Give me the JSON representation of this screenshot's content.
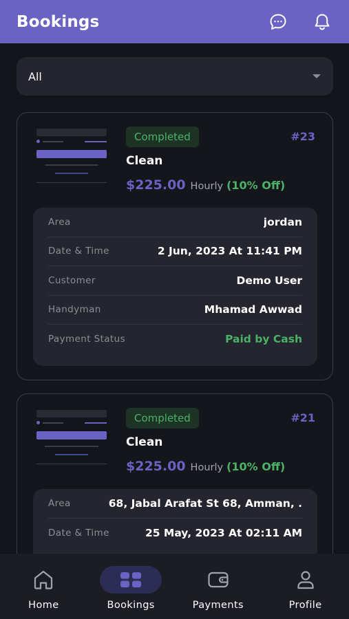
{
  "header": {
    "title": "Bookings",
    "chat_icon": "chat-bubble-icon",
    "bell_icon": "bell-icon"
  },
  "filter": {
    "selected": "All"
  },
  "bookings": [
    {
      "status": "Completed",
      "id": "#23",
      "service": "Clean",
      "price": "$225.00",
      "price_type": "Hourly",
      "discount": "(10% Off)",
      "details": [
        {
          "label": "Area",
          "value": "jordan"
        },
        {
          "label": "Date & Time",
          "value": "2 Jun, 2023 At 11:41 PM"
        },
        {
          "label": "Customer",
          "value": "Demo User"
        },
        {
          "label": "Handyman",
          "value": "Mhamad Awwad"
        },
        {
          "label": "Payment Status",
          "value": "Paid by Cash"
        }
      ]
    },
    {
      "status": "Completed",
      "id": "#21",
      "service": "Clean",
      "price": "$225.00",
      "price_type": "Hourly",
      "discount": "(10% Off)",
      "details": [
        {
          "label": "Area",
          "value": "68, Jabal Arafat St 68, Amman, ."
        },
        {
          "label": "Date & Time",
          "value": "25 May, 2023 At 02:11 AM"
        }
      ]
    }
  ],
  "nav": {
    "items": [
      {
        "label": "Home",
        "icon": "home-icon"
      },
      {
        "label": "Bookings",
        "icon": "bookings-icon"
      },
      {
        "label": "Payments",
        "icon": "wallet-icon"
      },
      {
        "label": "Profile",
        "icon": "profile-icon"
      }
    ],
    "active": "Bookings"
  },
  "colors": {
    "accent": "#6b63c4",
    "success": "#4cb267",
    "background": "#14151b",
    "surface": "#24252e"
  }
}
